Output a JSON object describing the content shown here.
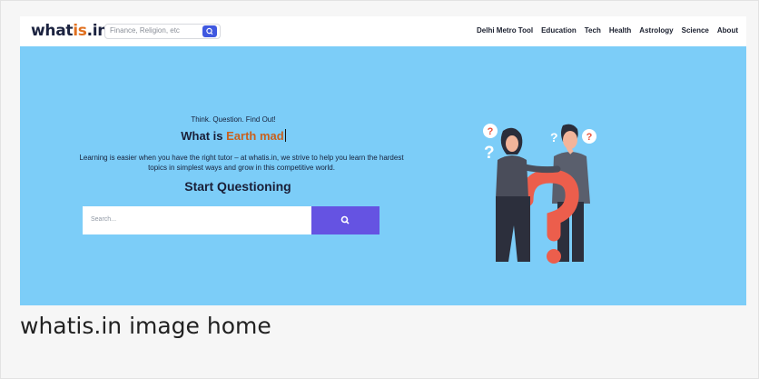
{
  "nav": {
    "logo_prefix": "what",
    "logo_accent": "is",
    "logo_suffix": ".in",
    "search_placeholder": "Finance, Religion, etc",
    "links": [
      "Delhi Metro Tool",
      "Education",
      "Tech",
      "Health",
      "Astrology",
      "Science",
      "About"
    ]
  },
  "hero": {
    "tagline": "Think. Question. Find Out!",
    "headline_prefix": "What is ",
    "headline_highlight": "Earth mad",
    "description": "Learning is easier when you have the right tutor – at whatis.in, we strive to help you learn the hardest topics in simplest ways and grow in this competitive world.",
    "cta": "Start Questioning",
    "search_placeholder": "Search..."
  },
  "caption": "whatis.in image home",
  "icons": {
    "nav_search": "search-icon",
    "hero_search": "search-icon",
    "illustration": "people-with-question-marks-illustration"
  },
  "colors": {
    "hero_bg": "#7ccdf8",
    "accent": "#e0701f",
    "search_button": "#6553e2",
    "nav_search_button": "#3f58e0"
  }
}
